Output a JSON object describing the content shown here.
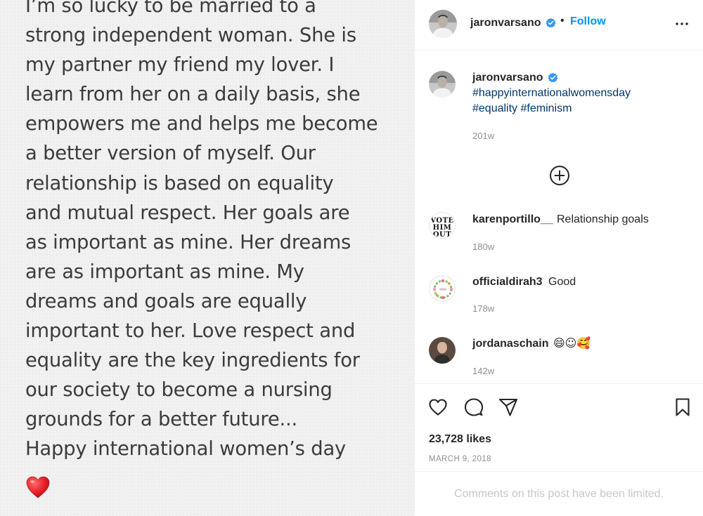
{
  "post_image": {
    "lines": [
      "I’m so lucky to be married to a",
      "strong independent woman. She is",
      "my partner my friend my lover. I",
      "learn from her on a daily basis, she",
      "empowers me and helps me become",
      "a better version of myself. Our",
      "relationship is based on equality",
      "and mutual respect. Her goals are",
      "as important as mine. Her dreams",
      "are as important as mine. My",
      "dreams and goals are equally",
      "important to her. Love respect and",
      "equality are the key ingredients for",
      "our society to become a nursing",
      "grounds for a better future...",
      "Happy international women’s day"
    ],
    "emoji_icon": "red-heart-emoji"
  },
  "header": {
    "username": "jaronvarsano",
    "verified_icon": "verified-badge-icon",
    "separator": "•",
    "follow_label": "Follow",
    "more_icon": "more-options-icon"
  },
  "caption": {
    "username": "jaronvarsano",
    "hashtags_line1": "#happyinternationalwomensday",
    "hashtags_line2": "#equality #feminism",
    "time": "201w"
  },
  "load_more_icon": "add-circle-icon",
  "comments": [
    {
      "username": "karenportillo__",
      "text": "Relationship goals",
      "time": "180w",
      "avatar_text": "VOTE HIM OUT"
    },
    {
      "username": "officialdirah3",
      "text": "Good",
      "time": "178w"
    },
    {
      "username": "jordanaschain",
      "text": "😄☺🥰",
      "time": "142w"
    }
  ],
  "actions": {
    "like_icon": "heart-outline-icon",
    "comment_icon": "comment-bubble-icon",
    "share_icon": "paper-plane-icon",
    "save_icon": "bookmark-icon",
    "likes": "23,728 likes",
    "date": "MARCH 9, 2018"
  },
  "comments_limited": "Comments on this post have been limited.",
  "colors": {
    "link_blue": "#0095f6",
    "hashtag_blue": "#00376b",
    "muted_gray": "#8e8e8e",
    "verified_blue": "#3897f0"
  }
}
